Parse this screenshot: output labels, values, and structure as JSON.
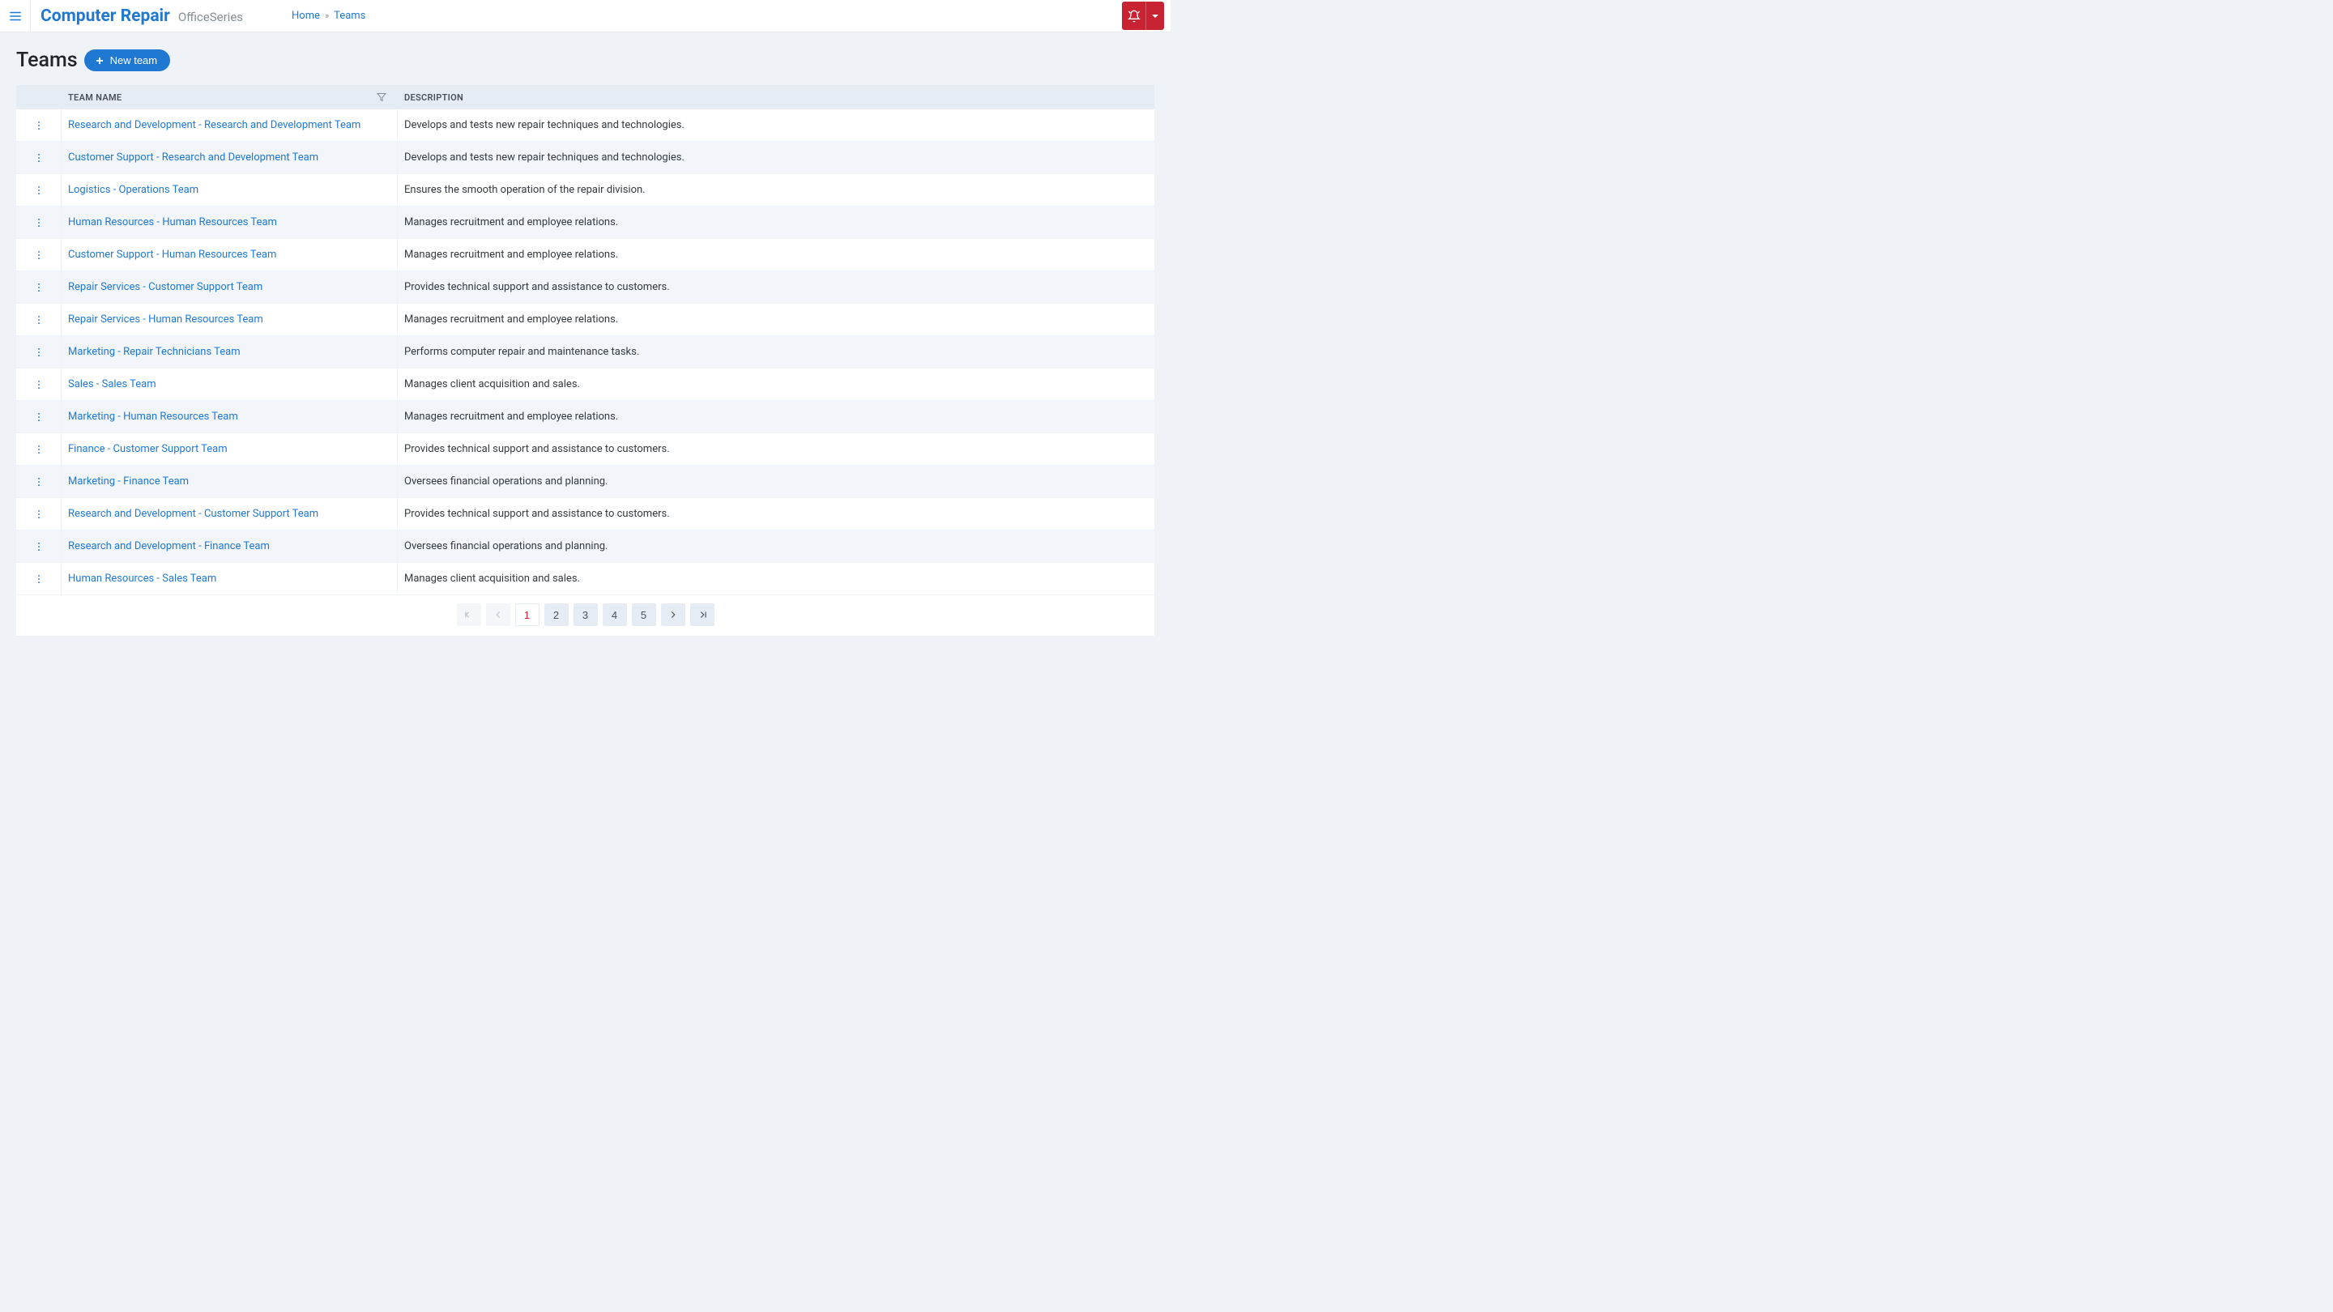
{
  "brand": {
    "main": "Computer Repair",
    "sub": "OfficeSeries"
  },
  "breadcrumb": {
    "home": "Home",
    "current": "Teams"
  },
  "page": {
    "title": "Teams",
    "new_button": "New team"
  },
  "columns": {
    "name": "TEAM NAME",
    "description": "DESCRIPTION"
  },
  "rows": [
    {
      "name": "Research and Development - Research and Development Team",
      "description": "Develops and tests new repair techniques and technologies."
    },
    {
      "name": "Customer Support - Research and Development Team",
      "description": "Develops and tests new repair techniques and technologies."
    },
    {
      "name": "Logistics - Operations Team",
      "description": "Ensures the smooth operation of the repair division."
    },
    {
      "name": "Human Resources - Human Resources Team",
      "description": "Manages recruitment and employee relations."
    },
    {
      "name": "Customer Support - Human Resources Team",
      "description": "Manages recruitment and employee relations."
    },
    {
      "name": "Repair Services - Customer Support Team",
      "description": "Provides technical support and assistance to customers."
    },
    {
      "name": "Repair Services - Human Resources Team",
      "description": "Manages recruitment and employee relations."
    },
    {
      "name": "Marketing - Repair Technicians Team",
      "description": "Performs computer repair and maintenance tasks."
    },
    {
      "name": "Sales - Sales Team",
      "description": "Manages client acquisition and sales."
    },
    {
      "name": "Marketing - Human Resources Team",
      "description": "Manages recruitment and employee relations."
    },
    {
      "name": "Finance - Customer Support Team",
      "description": "Provides technical support and assistance to customers."
    },
    {
      "name": "Marketing - Finance Team",
      "description": "Oversees financial operations and planning."
    },
    {
      "name": "Research and Development - Customer Support Team",
      "description": "Provides technical support and assistance to customers."
    },
    {
      "name": "Research and Development - Finance Team",
      "description": "Oversees financial operations and planning."
    },
    {
      "name": "Human Resources - Sales Team",
      "description": "Manages client acquisition and sales."
    }
  ],
  "pagination": {
    "pages": [
      "1",
      "2",
      "3",
      "4",
      "5"
    ],
    "current": "1"
  }
}
